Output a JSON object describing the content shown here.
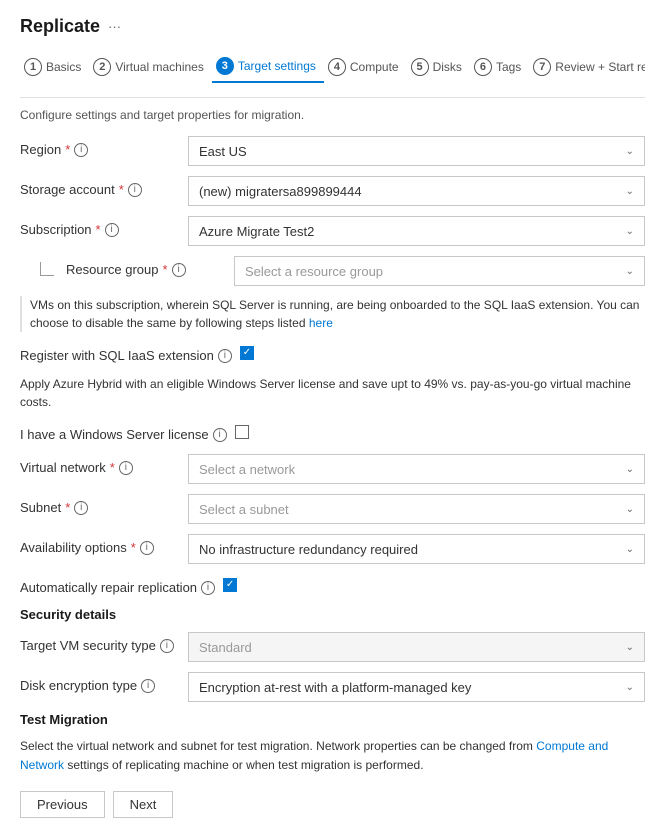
{
  "page": {
    "title": "Replicate",
    "ellipsis": "···",
    "subtitle": "Configure settings and target properties for migration."
  },
  "wizard": {
    "steps": [
      {
        "num": "1",
        "label": "Basics",
        "active": false
      },
      {
        "num": "2",
        "label": "Virtual machines",
        "active": false
      },
      {
        "num": "3",
        "label": "Target settings",
        "active": true
      },
      {
        "num": "4",
        "label": "Compute",
        "active": false
      },
      {
        "num": "5",
        "label": "Disks",
        "active": false
      },
      {
        "num": "6",
        "label": "Tags",
        "active": false
      },
      {
        "num": "7",
        "label": "Review + Start replication",
        "active": false
      }
    ]
  },
  "form": {
    "region_label": "Region",
    "region_value": "East US",
    "storage_label": "Storage account",
    "storage_value": "(new) migratersa899899444",
    "subscription_label": "Subscription",
    "subscription_value": "Azure Migrate Test2",
    "resource_group_label": "Resource group",
    "resource_group_placeholder": "Select a resource group",
    "sql_notice": "VMs on this subscription, wherein SQL Server is running, are being onboarded to the SQL IaaS extension. You can choose to disable the same by following steps listed",
    "sql_notice_link": "here",
    "sql_register_label": "Register with SQL IaaS extension",
    "hybrid_notice": "Apply Azure Hybrid with an eligible Windows Server license and save upt to 49% vs. pay-as-you-go virtual machine costs.",
    "windows_license_label": "I have a Windows Server license",
    "virtual_network_label": "Virtual network",
    "virtual_network_placeholder": "Select a network",
    "subnet_label": "Subnet",
    "subnet_placeholder": "Select a subnet",
    "availability_label": "Availability options",
    "availability_value": "No infrastructure redundancy required",
    "auto_repair_label": "Automatically repair replication",
    "security_heading": "Security details",
    "security_type_label": "Target VM security type",
    "security_type_value": "Standard",
    "disk_encryption_label": "Disk encryption type",
    "disk_encryption_value": "Encryption at-rest with a platform-managed key",
    "test_migration_heading": "Test Migration",
    "test_migration_notice": "Select the virtual network and subnet for test migration. Network properties can be changed from Compute and Network settings of replicating machine or when test migration is performed.",
    "test_migration_notice_link": "Compute and Network"
  },
  "buttons": {
    "previous": "Previous",
    "next": "Next"
  }
}
